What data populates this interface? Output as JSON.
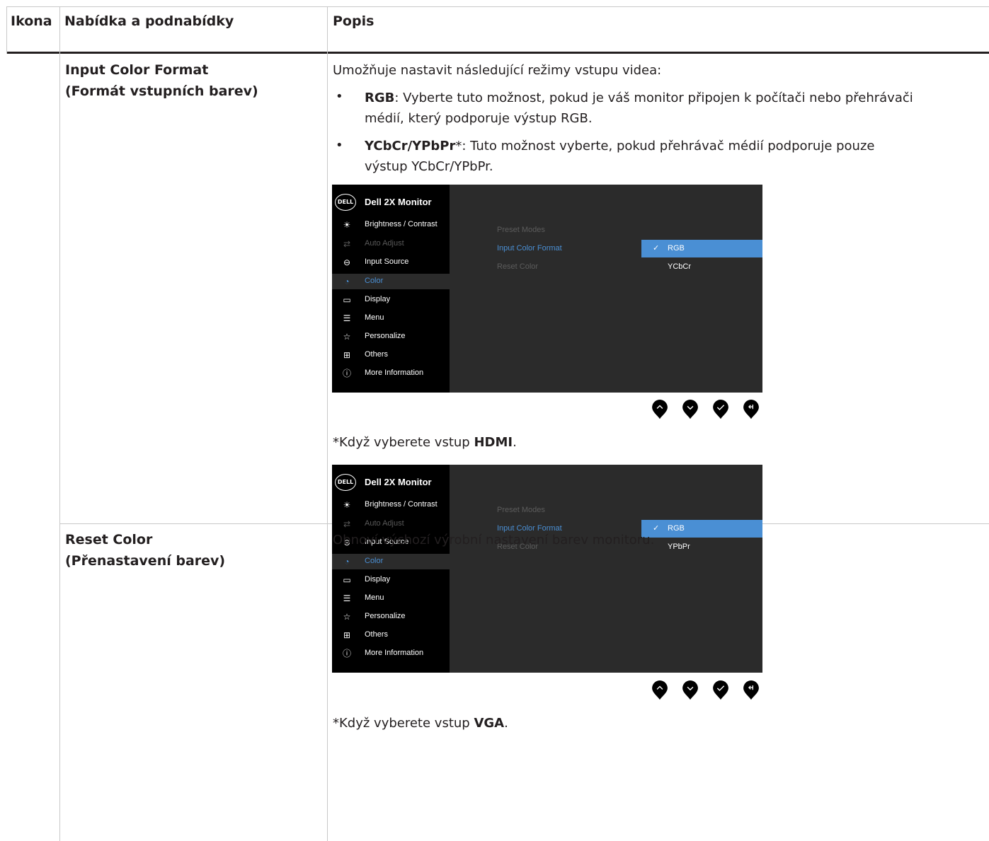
{
  "table": {
    "headers": {
      "icon": "Ikona",
      "menu": "Nabídka a podnabídky",
      "desc": "Popis"
    },
    "rows": [
      {
        "name_en": "Input Color Format",
        "name_cs": "(Formát vstupních barev)",
        "intro": "Umožňuje nastavit následující režimy vstupu videa:",
        "bullets": [
          {
            "term": "RGB",
            "text": ": Vyberte tuto možnost, pokud je váš monitor připojen k počítači nebo přehrávači",
            "text2": "médií, který podporuje výstup RGB."
          },
          {
            "term": "YCbCr/YPbPr",
            "text": "*: Tuto možnost vyberte, pokud přehrávač médií podporuje pouze",
            "text2": "výstup YCbCr/YPbPr."
          }
        ]
      },
      {
        "name_en": "Reset Color",
        "name_cs": "(Přenastavení barev)",
        "desc": "Obnoví výchozí výrobní nastavení barev monitoru."
      }
    ]
  },
  "osd": {
    "logo": "DELL",
    "title": "Dell 2X Monitor",
    "menu": [
      {
        "label": "Brightness / Contrast",
        "icon": "brightness-icon",
        "glyph": "☀",
        "state": "normal"
      },
      {
        "label": "Auto Adjust",
        "icon": "auto-adjust-icon",
        "glyph": "⇄",
        "state": "dim"
      },
      {
        "label": "Input Source",
        "icon": "input-source-icon",
        "glyph": "⊖",
        "state": "normal"
      },
      {
        "label": "Color",
        "icon": "color-icon",
        "glyph": "◔",
        "state": "selected"
      },
      {
        "label": "Display",
        "icon": "display-icon",
        "glyph": "▭",
        "state": "normal"
      },
      {
        "label": "Menu",
        "icon": "menu-icon",
        "glyph": "☰",
        "state": "normal"
      },
      {
        "label": "Personalize",
        "icon": "star-icon",
        "glyph": "☆",
        "state": "normal"
      },
      {
        "label": "Others",
        "icon": "others-icon",
        "glyph": "⊞",
        "state": "normal"
      },
      {
        "label": "More Information",
        "icon": "info-icon",
        "glyph": "ⓘ",
        "state": "normal"
      }
    ],
    "submenu": [
      "Preset Modes",
      "Input Color Format",
      "Reset Color"
    ],
    "screens": [
      {
        "options": [
          "RGB",
          "YCbCr"
        ],
        "note_prefix": "*Když vyberete vstup ",
        "note_bold": "HDMI",
        "note_suffix": "."
      },
      {
        "options": [
          "RGB",
          "YPbPr"
        ],
        "note_prefix": "*Když vyberete vstup ",
        "note_bold": "VGA",
        "note_suffix": "."
      }
    ],
    "buttons": [
      "up-icon",
      "down-icon",
      "check-icon",
      "back-icon"
    ]
  }
}
